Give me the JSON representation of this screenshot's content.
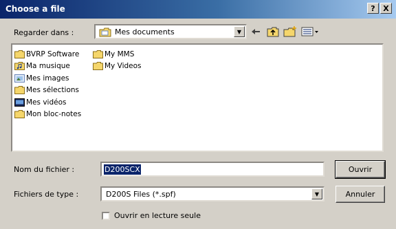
{
  "window": {
    "title": "Choose a file",
    "help_button": "?",
    "close_button": "X"
  },
  "look_in": {
    "label": "Regarder dans :",
    "value": "Mes documents"
  },
  "toolbar": {
    "icons": [
      "back-arrow-icon",
      "up-folder-icon",
      "new-folder-icon",
      "view-menu-icon"
    ]
  },
  "file_list": {
    "column1": [
      "BVRP Software",
      "Ma musique",
      "Mes images",
      "Mes sélections",
      "Mes vidéos",
      "Mon bloc-notes"
    ],
    "column2": [
      "My MMS",
      "My Videos"
    ]
  },
  "filename": {
    "label": "Nom du fichier :",
    "value": "D200SCX"
  },
  "filetype": {
    "label": "Fichiers de type :",
    "value": "D200S Files (*.spf)"
  },
  "buttons": {
    "open": "Ouvrir",
    "cancel": "Annuler"
  },
  "readonly": {
    "label": "Ouvrir en lecture seule"
  },
  "colors": {
    "title_start": "#0a246a",
    "title_end": "#a6caf0",
    "folder": "#f5d66b",
    "selection": "#0a246a",
    "face": "#d4d0c8"
  }
}
